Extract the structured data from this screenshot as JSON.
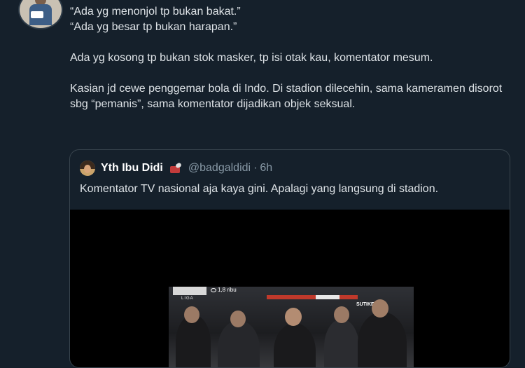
{
  "tweet": {
    "lines": [
      "“Ada yg menonjol tp bukan bakat.”",
      "“Ada yg besar tp bukan harapan.”",
      "Ada yg kosong tp bukan stok masker, tp isi otak kau, komentator mesum.",
      "Kasian jd cewe penggemar bola di Indo. Di stadion dilecehin, sama kameramen disorot sbg “pemanis”, sama komentator dijadikan objek seksual."
    ]
  },
  "quote": {
    "name": "Yth Ibu Didi",
    "emoji_icon": "microphone-emoji",
    "handle": "@badgaldidi",
    "separator": "·",
    "time": "6h",
    "text": "Komentator TV nasional aja kaya gini. Apalagi yang langsung di stadion.",
    "video": {
      "views": "1,8 ribu",
      "brand_text": "LIGA",
      "jersey_text": "SUTIKEN"
    }
  },
  "colors": {
    "background": "#15202b",
    "border": "#38444d",
    "secondary_text": "#8899a6",
    "primary_text": "#dde2e6"
  }
}
